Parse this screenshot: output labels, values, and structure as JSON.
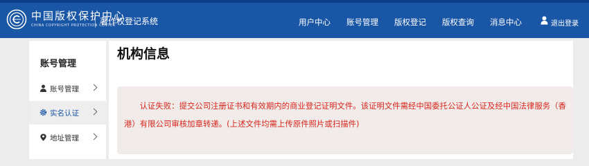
{
  "header": {
    "logo_cn": "中国版权保护中心",
    "logo_en": "CHINA COPYRIGHT PROTECTION CENTER",
    "system_name": "著作权登记系统",
    "nav": [
      "用户中心",
      "账号管理",
      "版权登记",
      "版权查询",
      "消息中心"
    ],
    "logout": "退出登录"
  },
  "sidebar": {
    "title": "账号管理",
    "items": [
      {
        "label": "账号管理",
        "icon": "user-icon"
      },
      {
        "label": "实名认证",
        "icon": "gear-icon",
        "active": true
      },
      {
        "label": "地址管理",
        "icon": "location-pin-icon"
      }
    ]
  },
  "main": {
    "title": "机构信息",
    "alert": "认证失败：提交公司注册证书和有效期内的商业登记证明文件。该证明文件需经中国委托公证人公证及经中国法律服务（香港）有限公司审核加章转递。(上述文件均需上传原件照片或扫描件)"
  },
  "colors": {
    "header_bg": "#1a56a6",
    "alert_text": "#d8261c",
    "alert_bg": "#f1ebea"
  }
}
